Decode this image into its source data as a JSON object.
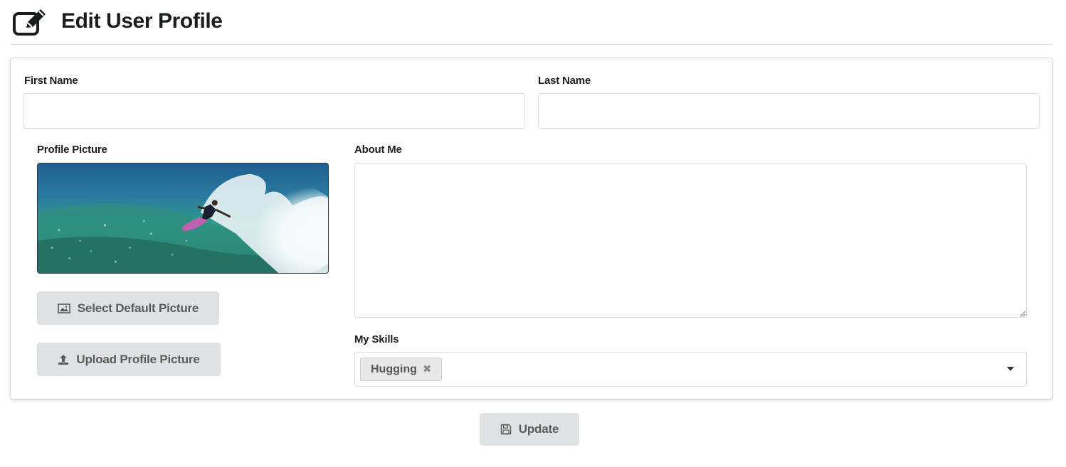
{
  "header": {
    "icon": "edit-icon",
    "title": "Edit User Profile"
  },
  "form": {
    "first_name": {
      "label": "First Name",
      "value": ""
    },
    "last_name": {
      "label": "Last Name",
      "value": ""
    },
    "profile_picture": {
      "label": "Profile Picture",
      "select_default_label": "Select Default Picture",
      "select_default_icon": "image-icon",
      "upload_label": "Upload Profile Picture",
      "upload_icon": "upload-icon"
    },
    "about_me": {
      "label": "About Me",
      "value": ""
    },
    "skills": {
      "label": "My Skills",
      "selected": [
        {
          "label": "Hugging",
          "remove_icon": "close-icon"
        }
      ],
      "dropdown_icon": "caret-down-icon"
    }
  },
  "actions": {
    "update_label": "Update",
    "update_icon": "save-icon"
  },
  "colors": {
    "button_bg": "#e0e1e2",
    "button_text": "#5a5a5a",
    "border": "#dedede",
    "chip_bg": "#e8e8e8"
  }
}
